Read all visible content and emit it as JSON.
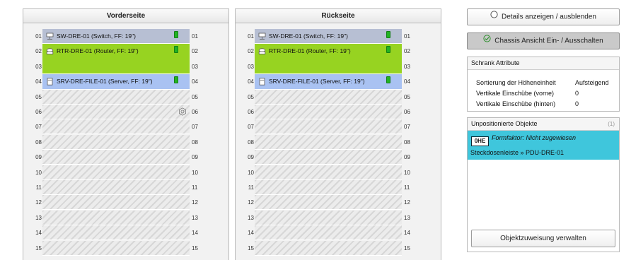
{
  "front": {
    "title": "Vorderseite",
    "devices": [
      {
        "label": "SW-DRE-01 (Switch, FF: 19\")",
        "icon": "switch-icon",
        "start": 1,
        "height": 1,
        "color": "#b7bfd3"
      },
      {
        "label": "RTR-DRE-01 (Router, FF: 19\")",
        "icon": "router-icon",
        "start": 2,
        "height": 2,
        "color": "#97d321"
      },
      {
        "label": "SRV-DRE-FILE-01 (Server, FF: 19\")",
        "icon": "server-icon",
        "start": 4,
        "height": 1,
        "color": "#a9c2f2"
      }
    ],
    "gear_unit": 6
  },
  "back": {
    "title": "Rückseite",
    "devices": [
      {
        "label": "SW-DRE-01 (Switch, FF: 19\")",
        "icon": "switch-icon",
        "start": 1,
        "height": 1,
        "color": "#b7bfd3"
      },
      {
        "label": "RTR-DRE-01 (Router, FF: 19\")",
        "icon": "router-icon",
        "start": 2,
        "height": 2,
        "color": "#97d321"
      },
      {
        "label": "SRV-DRE-FILE-01 (Server, FF: 19\")",
        "icon": "server-icon",
        "start": 4,
        "height": 1,
        "color": "#a9c2f2"
      }
    ]
  },
  "units": [
    "01",
    "02",
    "03",
    "04",
    "05",
    "06",
    "07",
    "08",
    "09",
    "10",
    "11",
    "12",
    "13",
    "14",
    "15"
  ],
  "buttons": {
    "details": "Details anzeigen / ausblenden",
    "chassis": "Chassis Ansicht Ein- / Ausschalten"
  },
  "attributes": {
    "title": "Schrank Attribute",
    "rows": [
      {
        "key": "Sortierung der Höheneinheit",
        "value": "Aufsteigend"
      },
      {
        "key": "Vertikale Einschübe (vorne)",
        "value": "0"
      },
      {
        "key": "Vertikale Einschübe (hinten)",
        "value": "0"
      }
    ]
  },
  "unpositioned": {
    "title": "Unpositionierte Objekte",
    "count": "(1)",
    "item": {
      "badge": "0HE",
      "form_factor": "Formfaktor: Nicht zugewiesen",
      "name": "Steckdosenleiste » PDU-DRE-01"
    },
    "manage_button": "Objektzuweisung verwalten"
  },
  "colors": {
    "status_led": "#22b322",
    "unpositioned_bg": "#3fc6dc"
  }
}
